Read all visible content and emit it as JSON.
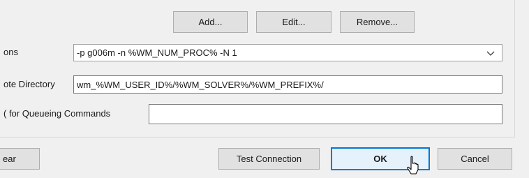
{
  "buttons": {
    "add": "Add...",
    "edit": "Edit...",
    "remove": "Remove...",
    "clear": "ear",
    "test_connection": "Test Connection",
    "ok": "OK",
    "cancel": "Cancel"
  },
  "fields": {
    "options": {
      "label": "ons",
      "value": "-p g006m -n %WM_NUM_PROC% -N 1"
    },
    "remote_directory": {
      "label": "ote Directory",
      "value": "wm_%WM_USER_ID%/%WM_SOLVER%/%WM_PREFIX%/"
    },
    "queueing_commands": {
      "label": "( for Queueing Commands",
      "value": ""
    }
  },
  "colors": {
    "accent": "#0078d7",
    "window_bg": "#f0f0f0",
    "button_bg": "#e1e1e1"
  },
  "icons": [
    "chevron-down-icon",
    "mouse-pointer-icon"
  ]
}
